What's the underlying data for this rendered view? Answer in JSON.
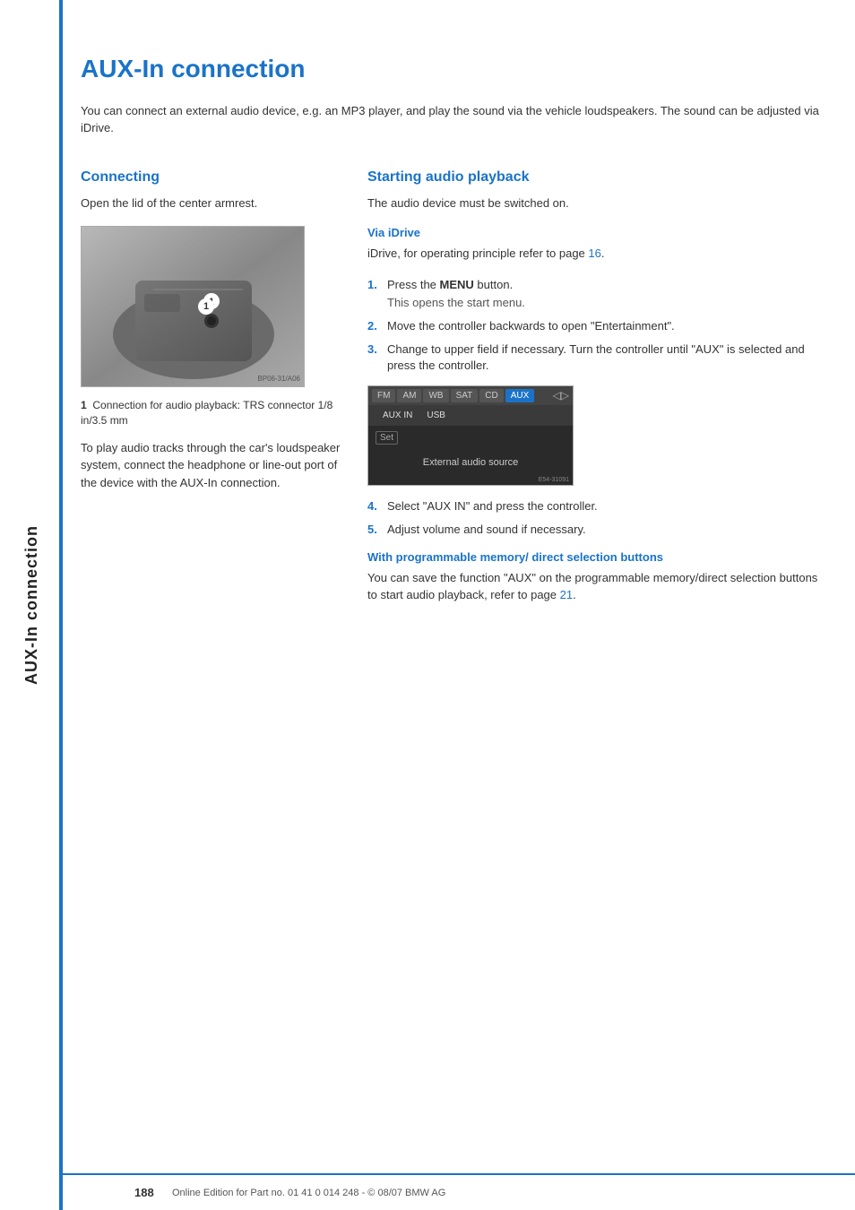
{
  "sidebar": {
    "label": "AUX-In connection"
  },
  "page": {
    "title": "AUX-In connection",
    "intro": "You can connect an external audio device, e.g. an MP3 player, and play the sound via the vehicle loudspeakers. The sound can be adjusted via iDrive.",
    "connecting": {
      "heading": "Connecting",
      "text": "Open the lid of the center armrest.",
      "caption_num": "1",
      "caption_text": "Connection for audio playback: TRS connector 1/8 in/3.5 mm",
      "body_text": "To play audio tracks through the car's loudspeaker system, connect the headphone or line-out port of the device with the AUX-In connection."
    },
    "starting": {
      "heading": "Starting audio playback",
      "intro": "The audio device must be switched on.",
      "via_idrive": {
        "subheading": "Via iDrive",
        "text_before": "iDrive, for operating principle refer to page ",
        "page_ref": "16",
        "text_after": ".",
        "steps": [
          {
            "num": "1.",
            "text": "Press the ",
            "bold": "MENU",
            "text_after": " button.",
            "sub": "This opens the start menu."
          },
          {
            "num": "2.",
            "text": "Move the controller backwards to open \"Entertainment\".",
            "sub": ""
          },
          {
            "num": "3.",
            "text": "Change to upper field if necessary. Turn the controller until \"AUX\" is selected and press the controller.",
            "sub": ""
          },
          {
            "num": "4.",
            "text": "Select \"AUX IN\" and press the controller.",
            "sub": ""
          },
          {
            "num": "5.",
            "text": "Adjust volume and sound if necessary.",
            "sub": ""
          }
        ],
        "screen": {
          "tabs": [
            "FM",
            "AM",
            "WB",
            "SAT",
            "CD",
            "AUX"
          ],
          "active_tab": "AUX",
          "submenu": [
            "AUX IN",
            "USB"
          ],
          "set_label": "Set",
          "body_label": "External audio source",
          "watermark": "E54-31091"
        }
      },
      "programmable": {
        "subheading": "With programmable memory/ direct selection buttons",
        "text": "You can save the function \"AUX\" on the programmable memory/direct selection buttons to start audio playback, refer to page ",
        "page_ref": "21",
        "text_after": "."
      }
    }
  },
  "footer": {
    "page_num": "188",
    "text": "Online Edition for Part no. 01 41 0 014 248 - © 08/07 BMW AG"
  }
}
